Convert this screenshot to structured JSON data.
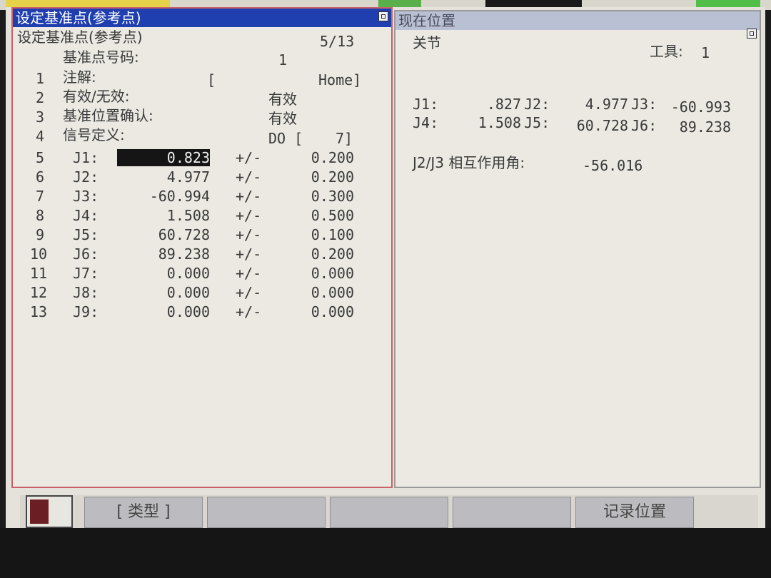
{
  "left_panel": {
    "title": "设定基准点(参考点)",
    "subtitle": "设定基准点(参考点)",
    "page": "5/13",
    "refnum_label": "基准点号码:",
    "refnum_value": "1",
    "rows_text": [
      {
        "num": "1",
        "label": "注解:",
        "value": "[",
        "value2": "Home]"
      },
      {
        "num": "2",
        "label": "有效/无效:",
        "value": "有效",
        "value2": ""
      },
      {
        "num": "3",
        "label": "基准位置确认:",
        "value": "有效",
        "value2": ""
      },
      {
        "num": "4",
        "label": "信号定义:",
        "value": "DO [",
        "value2": "7]"
      }
    ],
    "joints": [
      {
        "num": "5",
        "name": "J1:",
        "value": "0.823",
        "pm": "+/-",
        "tol": "0.200"
      },
      {
        "num": "6",
        "name": "J2:",
        "value": "4.977",
        "pm": "+/-",
        "tol": "0.200"
      },
      {
        "num": "7",
        "name": "J3:",
        "value": "-60.994",
        "pm": "+/-",
        "tol": "0.300"
      },
      {
        "num": "8",
        "name": "J4:",
        "value": "1.508",
        "pm": "+/-",
        "tol": "0.500"
      },
      {
        "num": "9",
        "name": "J5:",
        "value": "60.728",
        "pm": "+/-",
        "tol": "0.100"
      },
      {
        "num": "10",
        "name": "J6:",
        "value": "89.238",
        "pm": "+/-",
        "tol": "0.200"
      },
      {
        "num": "11",
        "name": "J7:",
        "value": "0.000",
        "pm": "+/-",
        "tol": "0.000"
      },
      {
        "num": "12",
        "name": "J8:",
        "value": "0.000",
        "pm": "+/-",
        "tol": "0.000"
      },
      {
        "num": "13",
        "name": "J9:",
        "value": "0.000",
        "pm": "+/-",
        "tol": "0.000"
      }
    ]
  },
  "right_panel": {
    "title": "现在位置",
    "mode": "关节",
    "tool_label": "工具:",
    "tool_value": "1",
    "positions": [
      {
        "label": "J1:",
        "value": ".827"
      },
      {
        "label": "J2:",
        "value": "4.977"
      },
      {
        "label": "J3:",
        "value": "-60.993"
      },
      {
        "label": "J4:",
        "value": "1.508"
      },
      {
        "label": "J5:",
        "value": "60.728"
      },
      {
        "label": "J6:",
        "value": "89.238"
      }
    ],
    "interaction_label": "J2/J3 相互作用角:",
    "interaction_value": "-56.016"
  },
  "softkeys": {
    "f1": "[ 类型 ]",
    "f2": "",
    "f3": "",
    "f4": "",
    "f5": "记录位置"
  },
  "colors": {
    "title_active": "#1f3fb0",
    "title_inactive": "#b9c0d3",
    "focus_border": "#c9606a",
    "highlight": "#151515"
  }
}
